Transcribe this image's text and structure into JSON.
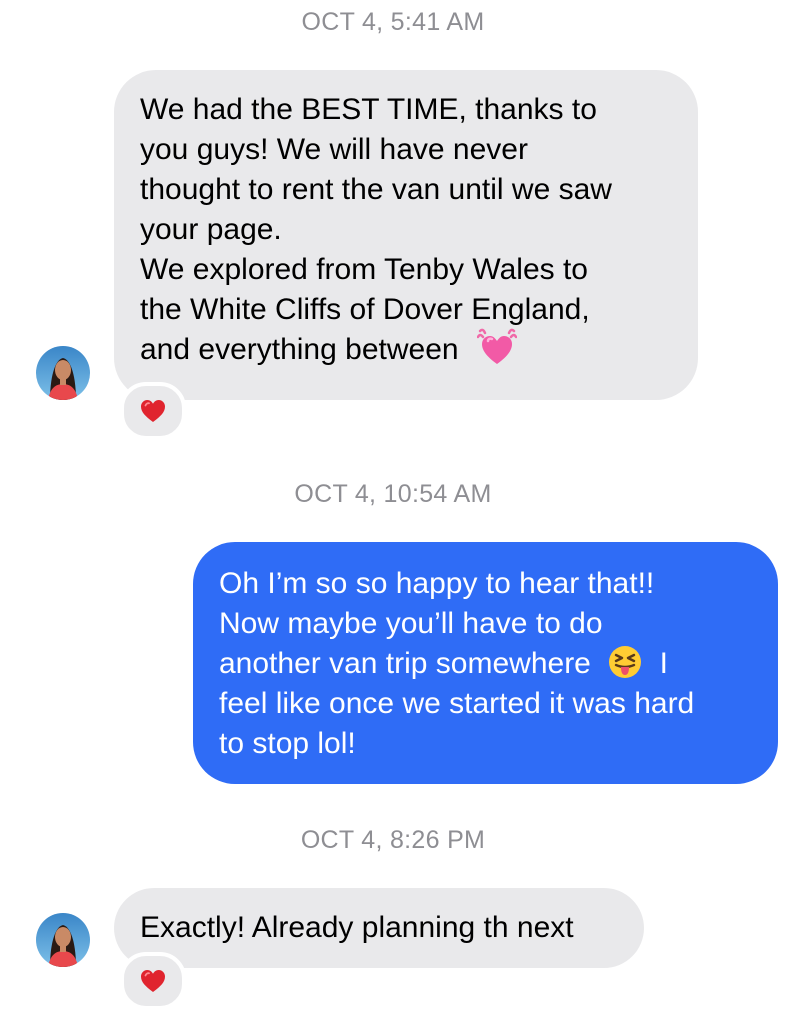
{
  "conversation": {
    "messages": [
      {
        "timestamp": "OCT 4, 5:41 AM",
        "direction": "incoming",
        "lines": [
          "We had the BEST TIME, thanks to",
          "you guys! We will have never",
          "thought to rent the van until we saw",
          "your page.",
          "We explored from Tenby Wales to",
          "the White Cliffs of Dover England,",
          "and everything between"
        ],
        "trailing_emoji": "beating-heart-icon",
        "reaction": "red-heart-icon"
      },
      {
        "timestamp": "OCT 4, 10:54 AM",
        "direction": "outgoing",
        "lines": [
          "Oh I’m so so happy to hear that!!",
          "Now maybe you’ll have to do",
          "another van trip somewhere",
          "feel like once we started it was hard",
          "to stop lol!"
        ],
        "line3_after_emoji": "I",
        "inline_emoji": "squinting-face-with-tongue-icon"
      },
      {
        "timestamp": "OCT 4, 8:26 PM",
        "direction": "incoming",
        "lines": [
          "Exactly! Already planning th next"
        ],
        "reaction": "red-heart-icon"
      }
    ]
  },
  "colors": {
    "incoming_bubble": "#e9e9eb",
    "outgoing_bubble": "#2f6cf6",
    "timestamp_text": "#8e8e93",
    "reaction_heart": "#e0242e"
  }
}
